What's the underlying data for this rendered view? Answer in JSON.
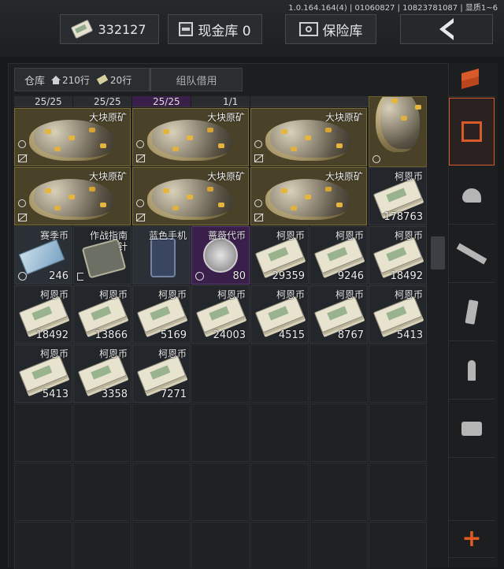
{
  "version": "1.0.164.164(4) | 01060827 | 10823781087 | 显质1~6",
  "topbar": {
    "cash_amount": "332127",
    "cash_vault_label": "现金库 0",
    "safe_label": "保险库"
  },
  "tabs": {
    "warehouse_label": "仓库",
    "home_rows": "210行",
    "money_rows": "20行",
    "team_borrow_label": "组队借用"
  },
  "top_stubs": [
    "25/25",
    "25/25",
    "25/25",
    "1/1"
  ],
  "ore": {
    "name": "大块原矿",
    "items": [
      {
        "name": "大块原矿"
      },
      {
        "name": "大块原矿"
      },
      {
        "name": "大块原矿"
      },
      {
        "name": "大块原矿"
      },
      {
        "name": "大块原矿"
      },
      {
        "name": "大块原矿"
      }
    ]
  },
  "row3_right": {
    "name": "柯恩币",
    "qty": "178763"
  },
  "items": [
    {
      "name": "赛季币",
      "qty": "246"
    },
    {
      "name": "作战指南针",
      "qty": ""
    },
    {
      "name": "蓝色手机",
      "qty": ""
    },
    {
      "name": "蔷薇代币",
      "qty": "80"
    },
    {
      "name": "柯恩币",
      "qty": "29359"
    },
    {
      "name": "柯恩币",
      "qty": "9246"
    },
    {
      "name": "柯恩币",
      "qty": "18492"
    },
    {
      "name": "柯恩币",
      "qty": "18492"
    },
    {
      "name": "柯恩币",
      "qty": "13866"
    },
    {
      "name": "柯恩币",
      "qty": "5169"
    },
    {
      "name": "柯恩币",
      "qty": "24003"
    },
    {
      "name": "柯恩币",
      "qty": "4515"
    },
    {
      "name": "柯恩币",
      "qty": "8767"
    },
    {
      "name": "柯恩币",
      "qty": "5413"
    },
    {
      "name": "柯恩币",
      "qty": "5413"
    },
    {
      "name": "柯恩币",
      "qty": "3358"
    },
    {
      "name": "柯恩币",
      "qty": "7271"
    }
  ],
  "compass_name_line1": "作战指南",
  "compass_name_line2": "针",
  "sidebar": [
    "all-items",
    "storage",
    "helmet",
    "rifle",
    "magazine",
    "ammo",
    "scope",
    "add"
  ]
}
